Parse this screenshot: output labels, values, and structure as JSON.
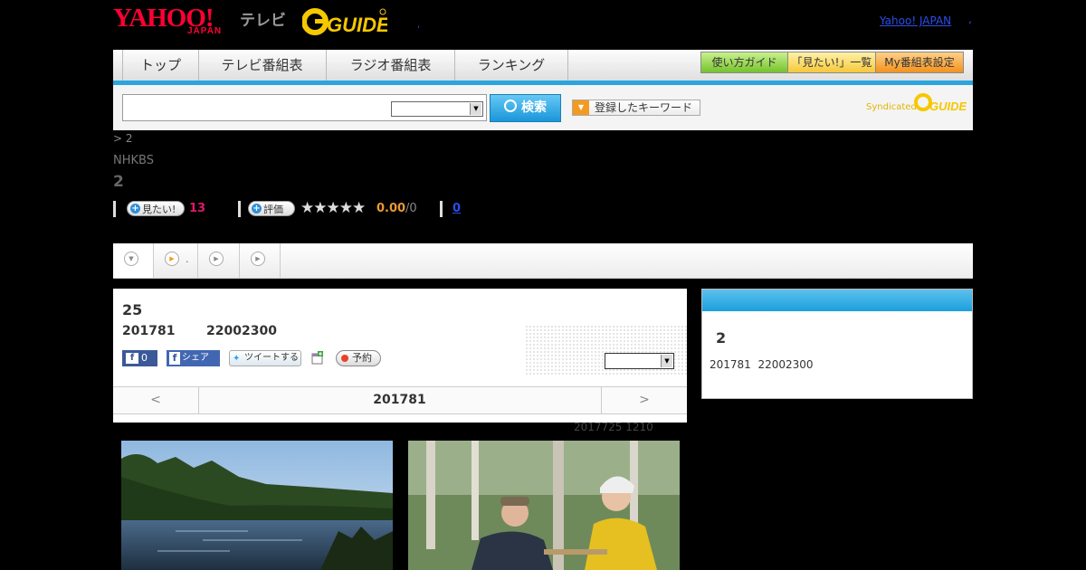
{
  "header": {
    "yahoo_logo": "YAHOO!",
    "yahoo_logo_sub": "JAPAN",
    "tv_label": "テレビ",
    "gguide_logo": "G-GUIDE",
    "small_dot": ",",
    "yahoo_japan_link": "Yahoo! JAPAN",
    "trailing_mark": ","
  },
  "nav": {
    "tabs": [
      "トップ",
      "テレビ番組表",
      "ラジオ番組表",
      "ランキング"
    ],
    "buttons": {
      "guide": "使い方ガイド",
      "mitai_list": "「見たい!」一覧",
      "my_schedule": "My番組表設定"
    },
    "accent_color": "#2aa5dd"
  },
  "search": {
    "input_value": "",
    "select_value": "",
    "search_button": "検索",
    "keyword_button": "登録したキーワード",
    "syndicated_label": "Syndicated",
    "syndicated_logo": "G-GUIDE"
  },
  "program": {
    "breadcrumb": "> 2",
    "channel": "NHKBS",
    "title": "2",
    "mitai_button": "見たい!",
    "mitai_count": "13",
    "rating_button": "評価",
    "stars": "★★★★★",
    "rating_score": "0.00",
    "rating_total": "/0",
    "review_count": "0"
  },
  "tabs_strip": {
    "second_label": "."
  },
  "detail": {
    "episode": "25",
    "date": "201781",
    "time": "22002300",
    "fb_like_count": "0",
    "fb_share": "シェア",
    "tweet": "ツイートする",
    "reserve": "予約",
    "reserve_select": ""
  },
  "pager": {
    "prev": "<",
    "current": "201781",
    "next": ">"
  },
  "updated": "2017725  1210",
  "sidebar": {
    "title": "2",
    "date": "201781",
    "time": "22002300"
  }
}
